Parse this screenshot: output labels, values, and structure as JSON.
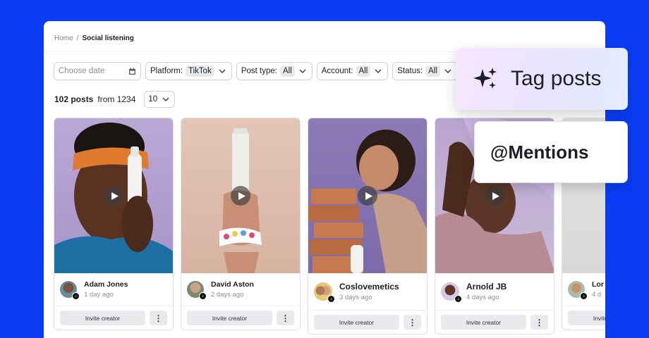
{
  "breadcrumb": {
    "home": "Home",
    "separator": "/",
    "current": "Social listening"
  },
  "filters": {
    "date_placeholder": "Choose date",
    "platform": {
      "label": "Platform:",
      "value": "TikTok"
    },
    "post_type": {
      "label": "Post type:",
      "value": "All"
    },
    "account": {
      "label": "Account:",
      "value": "All"
    },
    "status": {
      "label": "Status:",
      "value": "All"
    }
  },
  "summary": {
    "count": "102 posts",
    "from": "from 1234",
    "page_size": "10"
  },
  "posts": [
    {
      "name": "Adam Jones",
      "ago": "1 day ago",
      "invite": "Invite creator",
      "more": "⋮"
    },
    {
      "name": "David Aston",
      "ago": "2 days ago",
      "invite": "Invite creator",
      "more": "⋮"
    },
    {
      "name": "Coslovemetics",
      "ago": "3 days ago",
      "invite": "Invite creator",
      "more": "⋮"
    },
    {
      "name": "Arnold JB",
      "ago": "4 days ago",
      "invite": "Invite creator",
      "more": "⋮"
    },
    {
      "name": "Lor",
      "ago": "4 d",
      "invite": "Invite creator",
      "more": "⋮"
    }
  ],
  "popups": {
    "tag_posts": "Tag posts",
    "mentions": "@Mentions"
  },
  "colors": {
    "background": "#0a3cf5",
    "panel": "#ffffff",
    "button": "#e8eaee"
  },
  "icons": [
    "calendar-icon",
    "chevron-down-icon",
    "play-icon",
    "tiktok-icon",
    "more-icon",
    "sparkles-icon"
  ]
}
